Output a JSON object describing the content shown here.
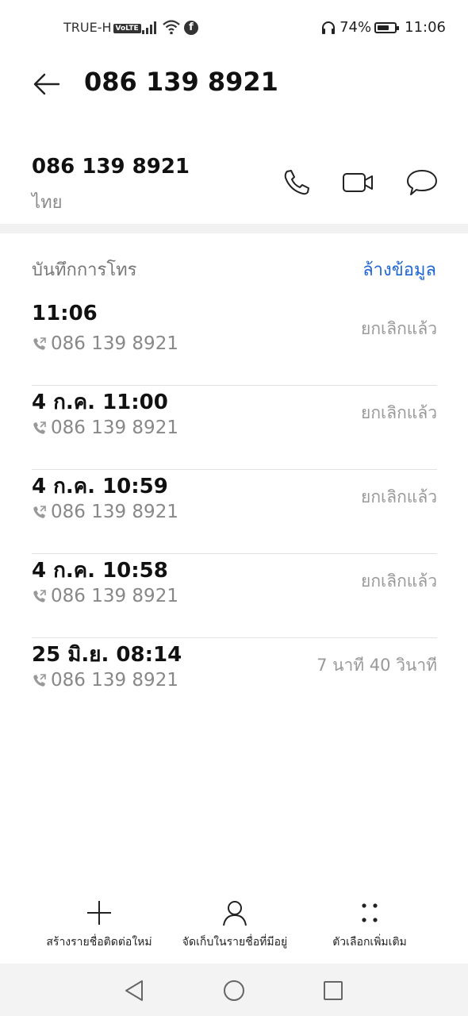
{
  "status_bar": {
    "carrier": "TRUE-H",
    "volte": "VoLTE",
    "battery": "74%",
    "time": "11:06",
    "battery_level": 0.74
  },
  "header": {
    "title": "086 139 8921"
  },
  "contact": {
    "number": "086 139 8921",
    "country": "ไทย"
  },
  "call_log": {
    "heading": "บันทึกการโทร",
    "clear_label": "ล้างข้อมูล",
    "entries": [
      {
        "datetime": "11:06",
        "number": "086 139 8921",
        "status": "ยกเลิกแล้ว"
      },
      {
        "datetime": "4 ก.ค. 11:00",
        "number": "086 139 8921",
        "status": "ยกเลิกแล้ว"
      },
      {
        "datetime": "4 ก.ค. 10:59",
        "number": "086 139 8921",
        "status": "ยกเลิกแล้ว"
      },
      {
        "datetime": "4 ก.ค. 10:58",
        "number": "086 139 8921",
        "status": "ยกเลิกแล้ว"
      },
      {
        "datetime": "25 มิ.ย. 08:14",
        "number": "086 139 8921",
        "status": "7 นาที 40 วินาที"
      }
    ]
  },
  "toolbar": {
    "new_contact": "สร้างรายชื่อติดต่อใหม่",
    "save_existing": "จัดเก็บในรายชื่อที่มีอยู่",
    "more": "ตัวเลือกเพิ่มเติม"
  },
  "colors": {
    "accent": "#1f67d2",
    "muted": "#888888"
  }
}
